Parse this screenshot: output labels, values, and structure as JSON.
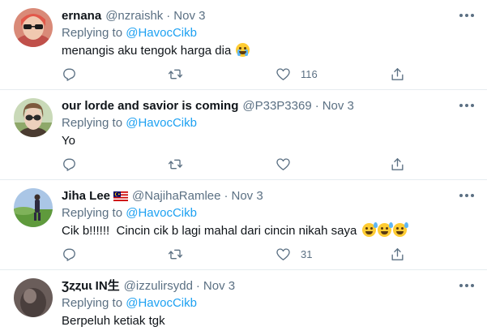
{
  "tweets": [
    {
      "name": "ernana",
      "handle": "@nzraishk",
      "dot": "·",
      "date": "Nov 3",
      "replying_prefix": "Replying to",
      "replying_to": "@HavocCikb",
      "text": "menangis aku tengok harga dia",
      "emoji": [
        "loudly-crying-face"
      ],
      "actions": {
        "reply_count": "",
        "retweet_count": "",
        "like_count": "116"
      },
      "icons": {
        "reply": "reply-icon",
        "retweet": "retweet-icon",
        "like": "heart-icon",
        "share": "share-icon"
      }
    },
    {
      "name": "our lorde and savior is coming",
      "handle": "@P33P3369",
      "dot": "·",
      "date": "Nov 3",
      "replying_prefix": "Replying to",
      "replying_to": "@HavocCikb",
      "text": "Yo",
      "emoji": [],
      "actions": {
        "reply_count": "",
        "retweet_count": "",
        "like_count": ""
      }
    },
    {
      "name": "Jiha Lee",
      "handle": "@NajihaRamlee",
      "dot": "·",
      "date": "Nov 3",
      "flag": "malaysia-flag",
      "replying_prefix": "Replying to",
      "replying_to": "@HavocCikb",
      "text": "Cik b!!!!!!  Cincin cik b lagi mahal dari cincin nikah saya",
      "emoji": [
        "grinning-sweat-face",
        "grinning-sweat-face",
        "grinning-sweat-face"
      ],
      "actions": {
        "reply_count": "",
        "retweet_count": "",
        "like_count": "31"
      }
    },
    {
      "name": "Ʒȥȥuɩ IN生",
      "handle": "@izzulirsydd",
      "dot": "·",
      "date": "Nov 3",
      "replying_prefix": "Replying to",
      "replying_to": "@HavocCikb",
      "text": "Berpeluh ketiak tgk",
      "emoji": []
    }
  ],
  "colors": {
    "link": "#1da1f2",
    "secondary_text": "#5b7083",
    "divider": "#e6ecf0"
  }
}
